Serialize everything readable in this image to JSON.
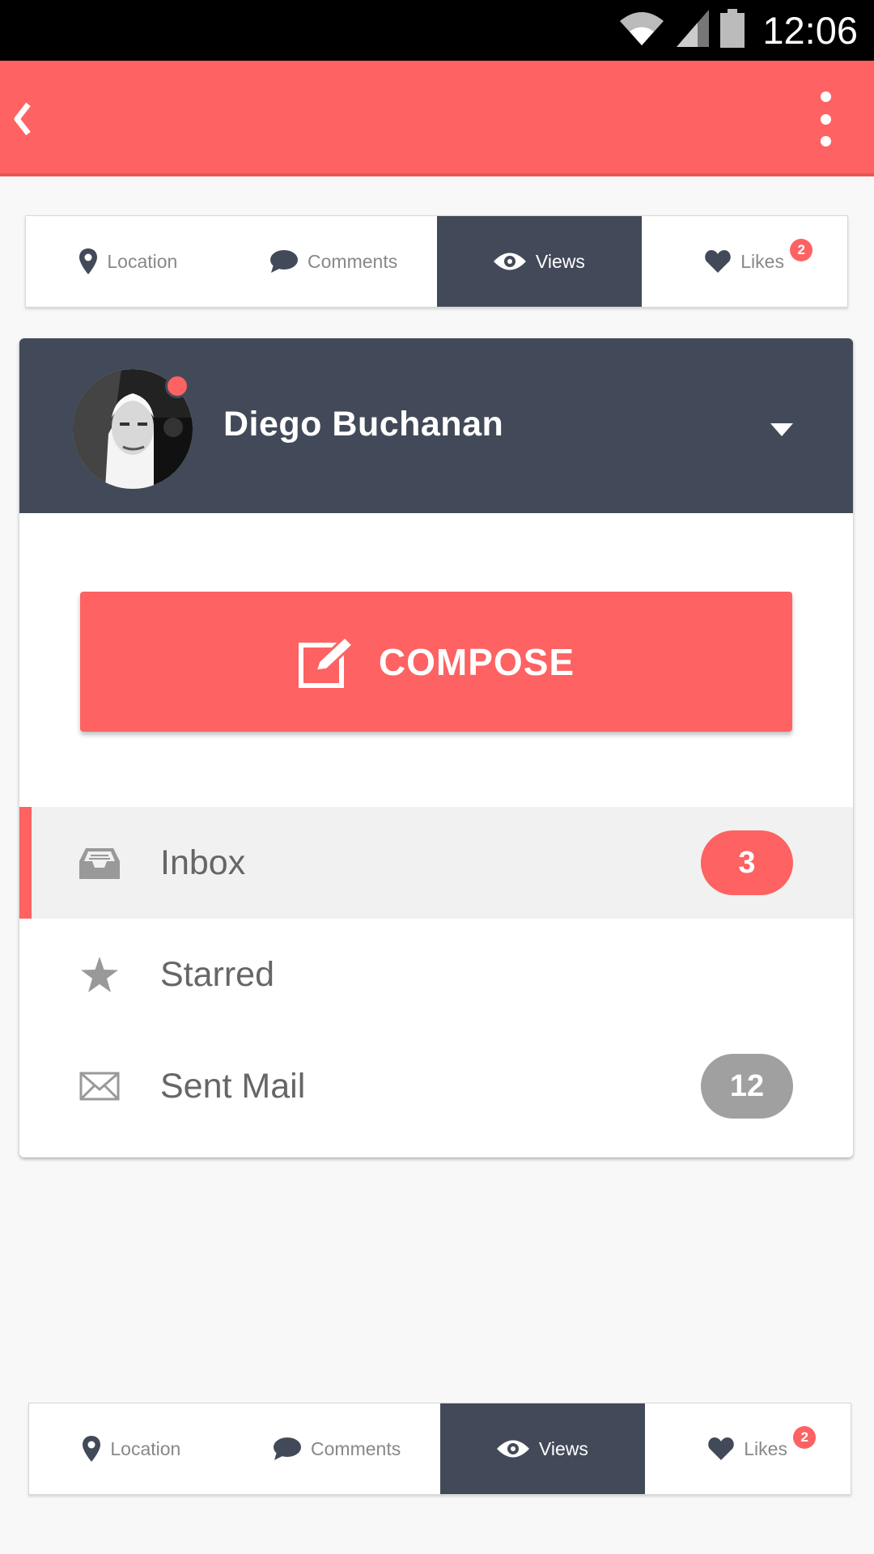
{
  "status_bar": {
    "time": "12:06"
  },
  "tabs": [
    {
      "label": "Location",
      "icon": "location-icon",
      "active": false
    },
    {
      "label": "Comments",
      "icon": "comment-icon",
      "active": false
    },
    {
      "label": "Views",
      "icon": "eye-icon",
      "active": true
    },
    {
      "label": "Likes",
      "icon": "heart-icon",
      "active": false,
      "badge": "2"
    }
  ],
  "profile": {
    "name": "Diego Buchanan"
  },
  "compose": {
    "label": "COMPOSE"
  },
  "mail_folders": [
    {
      "label": "Inbox",
      "icon": "inbox-icon",
      "count": "3",
      "selected": true
    },
    {
      "label": "Starred",
      "icon": "star-icon"
    },
    {
      "label": "Sent Mail",
      "icon": "envelope-icon",
      "count": "12"
    }
  ],
  "colors": {
    "accent": "#fe6262",
    "dark": "#424a59",
    "badge_grey": "#a0a0a0"
  }
}
